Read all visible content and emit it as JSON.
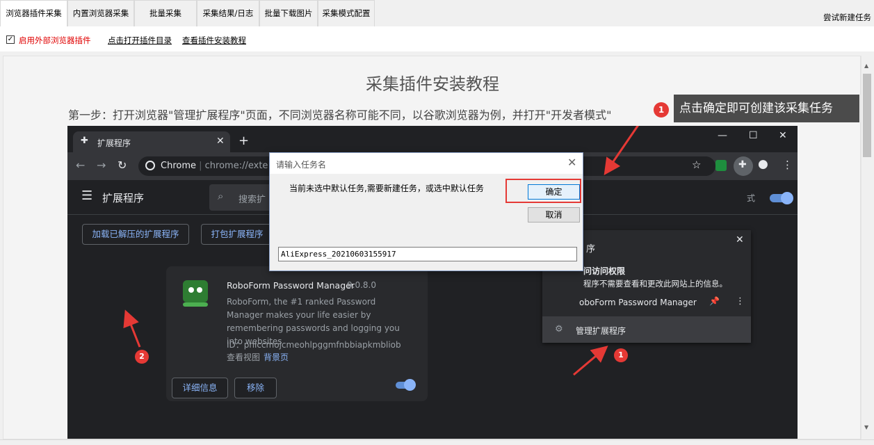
{
  "tabs": [
    {
      "label": "浏览器插件采集",
      "active": true
    },
    {
      "label": "内置浏览器采集",
      "active": false
    },
    {
      "label": "批量采集",
      "active": false
    },
    {
      "label": "采集结果/日志",
      "active": false
    },
    {
      "label": "批量下载图片",
      "active": false
    },
    {
      "label": "采集模式配置",
      "active": false
    }
  ],
  "try_new_task": "尝试新建任务",
  "options": {
    "enable_external_plugin": {
      "label": "启用外部浏览器插件",
      "checked": true
    },
    "open_plugin_dir": "点击打开插件目录",
    "view_install_tutorial": "查看插件安装教程"
  },
  "tutorial": {
    "title": "采集插件安装教程",
    "step1": "第一步：打开浏览器\"管理扩展程序\"页面，不同浏览器名称可能不同，以谷歌浏览器为例，并打开\"开发者模式\"",
    "callout_badge": "1",
    "callout_text": "点击确定即可创建该采集任务"
  },
  "chrome": {
    "tab_title": "扩展程序",
    "omnibox_brand": "Chrome",
    "omnibox_url": "chrome://exte",
    "page_heading": "扩展程序",
    "search_placeholder": "搜索扩",
    "dev_mode_label_tail": "式",
    "load_unpacked": "加载已解压的扩展程序",
    "pack_extension": "打包扩展程序",
    "card": {
      "name": "RoboForm Password Manager",
      "version": "9.0.8.0",
      "description": "RoboForm, the #1 ranked Password Manager makes your life easier by remembering passwords and logging you into websites",
      "id": "ID：pnlccmojcmeohlpggmfnbbiapkmbliob",
      "view_label": "查看视图",
      "view_link": "背景页",
      "details_button": "详细信息",
      "remove_button": "移除"
    },
    "menu": {
      "title_tail": "序",
      "access_title": "问访问权限",
      "access_desc": "程序不需要查看和更改此网站上的信息。",
      "item_name": "oboForm Password Manager",
      "manage_label": "管理扩展程序"
    },
    "badges": {
      "manage": "1",
      "load": "2"
    }
  },
  "dialog": {
    "title": "请输入任务名",
    "message": "当前未选中默认任务,需要新建任务，或选中默认任务",
    "ok": "确定",
    "cancel": "取消",
    "task_name_value": "AliExpress_20210603155917"
  },
  "colors": {
    "accent_red": "#e53935",
    "link_blue": "#8ab4f8"
  }
}
